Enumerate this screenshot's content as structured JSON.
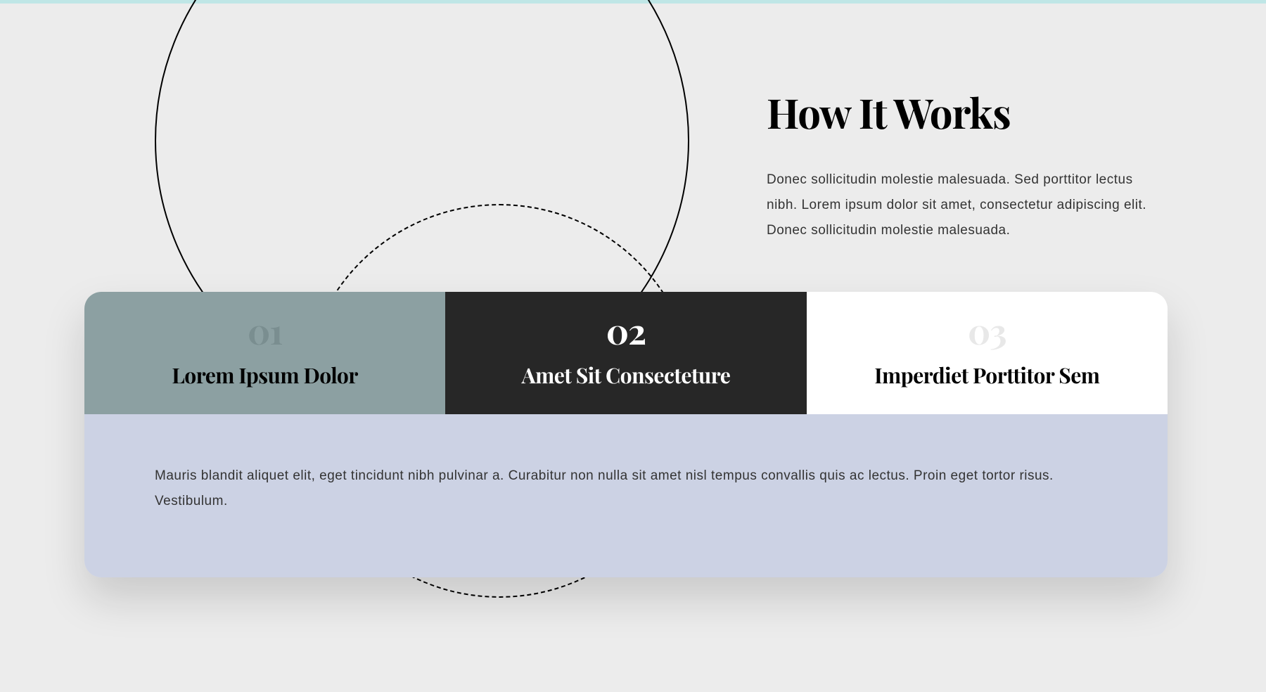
{
  "header": {
    "title": "How It Works",
    "description": "Donec sollicitudin molestie malesuada. Sed porttitor lectus nibh. Lorem ipsum dolor sit amet, consectetur adipiscing elit. Donec sollicitudin molestie malesuada."
  },
  "tabs": [
    {
      "number": "01",
      "title": "Lorem Ipsum Dolor"
    },
    {
      "number": "02",
      "title": "Amet Sit Consecteture"
    },
    {
      "number": "03",
      "title": "Imperdiet Porttitor Sem"
    }
  ],
  "body_text": "Mauris blandit aliquet elit, eget tincidunt nibh pulvinar a. Curabitur non nulla sit amet nisl tempus convallis quis ac lectus. Proin eget tortor risus. Vestibulum."
}
